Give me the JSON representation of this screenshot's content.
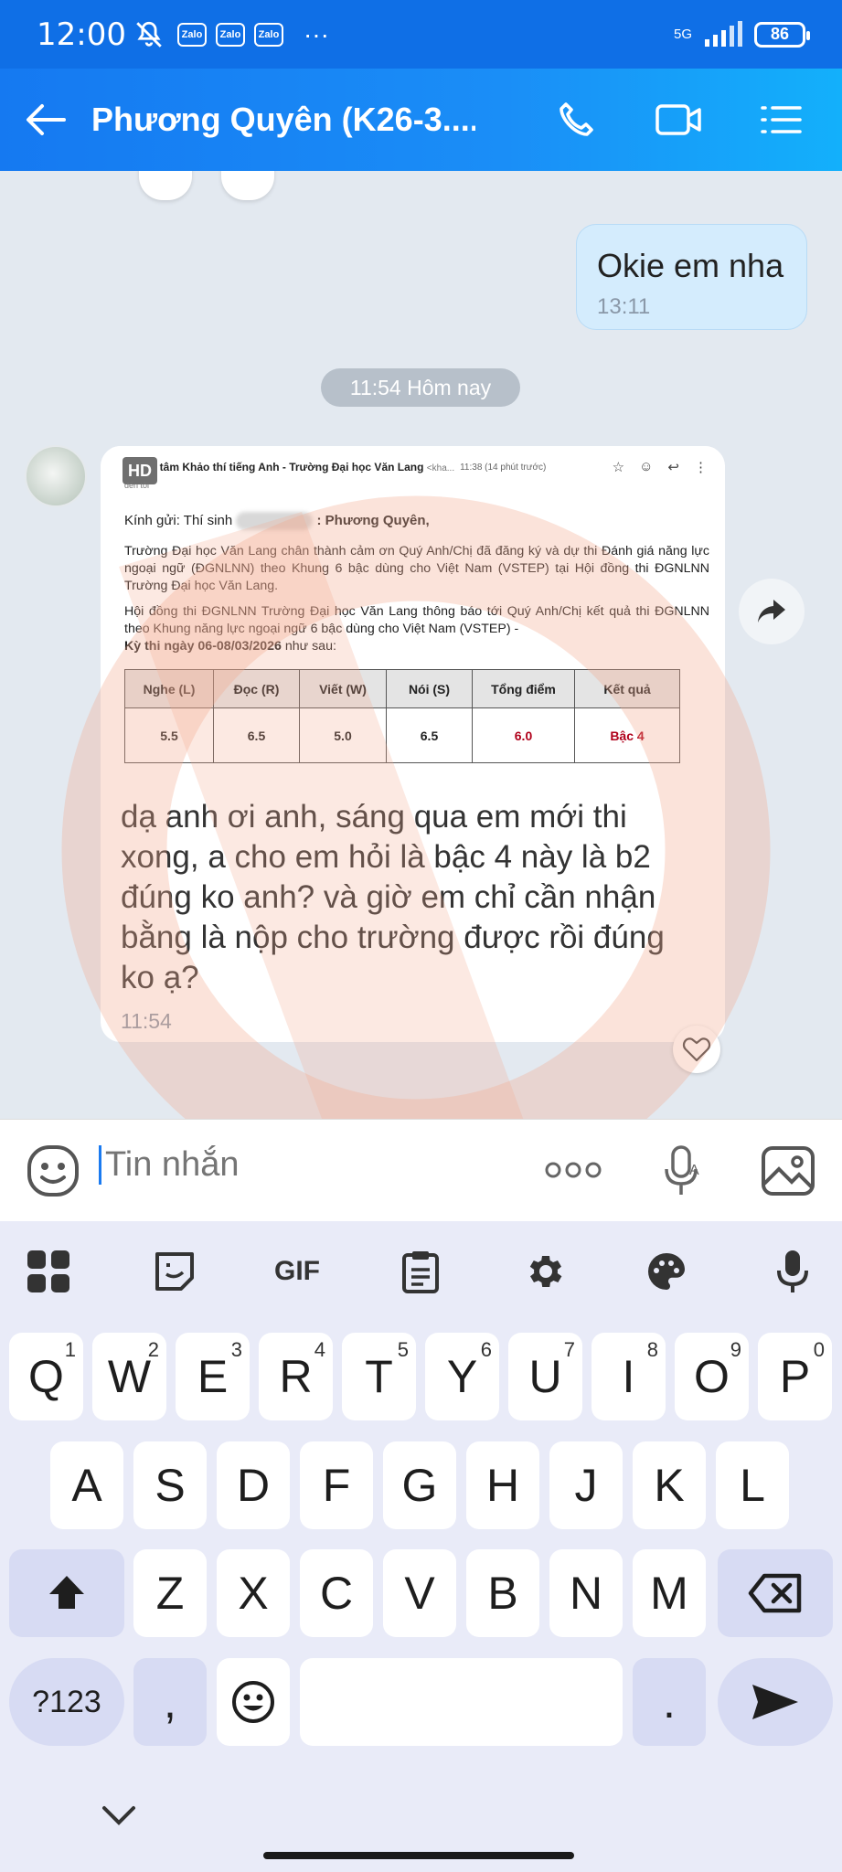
{
  "status_bar": {
    "time": "12:00",
    "notif_apps": [
      "Zalo",
      "Zalo",
      "Zalo"
    ],
    "more": "···",
    "network": "5G",
    "battery": "86"
  },
  "header": {
    "contact_name": "Phương Quyên (K26-3...."
  },
  "conversation": {
    "outgoing": {
      "text": "Okie em nha",
      "time": "13:11"
    },
    "date_separator": "11:54 Hôm nay",
    "incoming": {
      "image_badge": "HD",
      "email": {
        "sender": "Trung tâm Khảo thí tiếng Anh - Trường Đại học Văn Lang",
        "sender_email": "<kha...",
        "received": "11:38 (14 phút trước)",
        "to": "đến tôi",
        "greeting_prefix": "Kính gửi: Thí sinh",
        "greeting_name": ": Phương Quyên,",
        "paragraph1": "Trường Đại học Văn Lang chân thành cảm ơn Quý Anh/Chị đã đăng ký và dự thi Đánh giá năng lực ngoại ngữ (ĐGNLNN) theo Khung 6 bậc dùng cho Việt Nam (VSTEP) tại Hội đồng thi ĐGNLNN Trường Đại học Văn Lang.",
        "paragraph2": "Hội đồng thi ĐGNLNN Trường Đại học Văn Lang thông báo tới Quý Anh/Chị kết quả thi ĐGNLNN theo Khung năng lực ngoại ngữ 6 bậc dùng cho Việt Nam (VSTEP) -",
        "exam_date": "Kỳ thi ngày 06-08/03/2026",
        "exam_date_suffix": " như sau:",
        "table": {
          "headers": [
            "Nghe (L)",
            "Đọc (R)",
            "Viết (W)",
            "Nói (S)",
            "Tổng điểm",
            "Kết quả"
          ],
          "values": [
            "5.5",
            "6.5",
            "5.0",
            "6.5",
            "6.0",
            "Bậc 4"
          ]
        }
      },
      "text": "dạ anh ơi anh, sáng qua em mới thi xong, a cho em hỏi là bậc 4 này là b2 đúng ko anh? và giờ em chỉ cần nhận bằng là nộp cho trường được rồi đúng ko ạ?",
      "time": "11:54"
    }
  },
  "composer": {
    "placeholder": "Tin nhắn"
  },
  "keyboard": {
    "toolbar": [
      "apps-icon",
      "sticker-icon",
      "GIF",
      "clipboard-icon",
      "settings-icon",
      "palette-icon",
      "mic-icon"
    ],
    "row1": [
      {
        "k": "Q",
        "n": "1"
      },
      {
        "k": "W",
        "n": "2"
      },
      {
        "k": "E",
        "n": "3"
      },
      {
        "k": "R",
        "n": "4"
      },
      {
        "k": "T",
        "n": "5"
      },
      {
        "k": "Y",
        "n": "6"
      },
      {
        "k": "U",
        "n": "7"
      },
      {
        "k": "I",
        "n": "8"
      },
      {
        "k": "O",
        "n": "9"
      },
      {
        "k": "P",
        "n": "0"
      }
    ],
    "row2": [
      "A",
      "S",
      "D",
      "F",
      "G",
      "H",
      "J",
      "K",
      "L"
    ],
    "row3": [
      "Z",
      "X",
      "C",
      "V",
      "B",
      "N",
      "M"
    ],
    "symbols": "?123",
    "comma": ",",
    "period": "."
  },
  "colors": {
    "header": "#1579f1",
    "accent_red": "#b0001a",
    "outgoing_bubble": "#d4ecfd"
  }
}
